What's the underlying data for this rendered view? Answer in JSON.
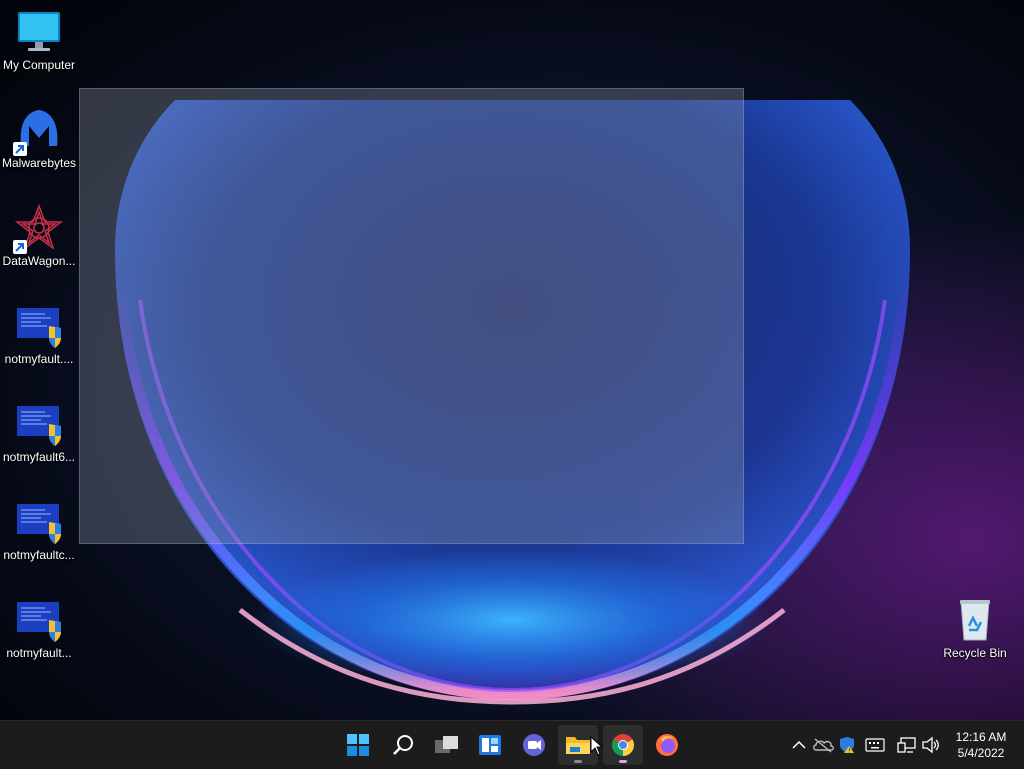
{
  "desktop": {
    "icons": [
      {
        "name": "my-computer",
        "label": "My Computer",
        "icon": "monitor-icon"
      },
      {
        "name": "malwarebytes",
        "label": "Malwarebytes",
        "icon": "malwarebytes-icon",
        "shortcut": true
      },
      {
        "name": "datawagon",
        "label": "DataWagon...",
        "icon": "datawagon-icon",
        "shortcut": true
      },
      {
        "name": "notmyfault-1",
        "label": "notmyfault....",
        "icon": "notmyfault-icon"
      },
      {
        "name": "notmyfault-2",
        "label": "notmyfault6...",
        "icon": "notmyfault-icon"
      },
      {
        "name": "notmyfault-3",
        "label": "notmyfaultc...",
        "icon": "notmyfault-icon"
      },
      {
        "name": "notmyfault-4",
        "label": "notmyfault...",
        "icon": "notmyfault-icon"
      }
    ],
    "recycle_bin": {
      "label": "Recycle Bin",
      "icon": "recycle-bin-icon"
    }
  },
  "taskbar": {
    "pinned": [
      {
        "name": "start",
        "icon": "windows-start-icon"
      },
      {
        "name": "search",
        "icon": "search-icon"
      },
      {
        "name": "task-view",
        "icon": "task-view-icon"
      },
      {
        "name": "widgets",
        "icon": "widgets-icon"
      },
      {
        "name": "chat",
        "icon": "teams-chat-icon"
      },
      {
        "name": "file-explorer",
        "icon": "folder-icon",
        "running": true
      },
      {
        "name": "chrome",
        "icon": "chrome-icon",
        "running": true,
        "focused": true
      },
      {
        "name": "firefox",
        "icon": "firefox-icon"
      }
    ],
    "tray": {
      "icons": [
        "chevron-up-icon",
        "onedrive-icon",
        "defender-icon",
        "keyboard-icon",
        "network-icon",
        "volume-icon"
      ],
      "time": "12:16 AM",
      "date": "5/4/2022"
    }
  },
  "colors": {
    "taskbar_bg": "#1c1c1c",
    "wallpaper_dark": "#05070f",
    "bloom_blue": "#1e7fe0",
    "bloom_purple": "#8a2be2",
    "bloom_pink": "#ff6fb0"
  }
}
